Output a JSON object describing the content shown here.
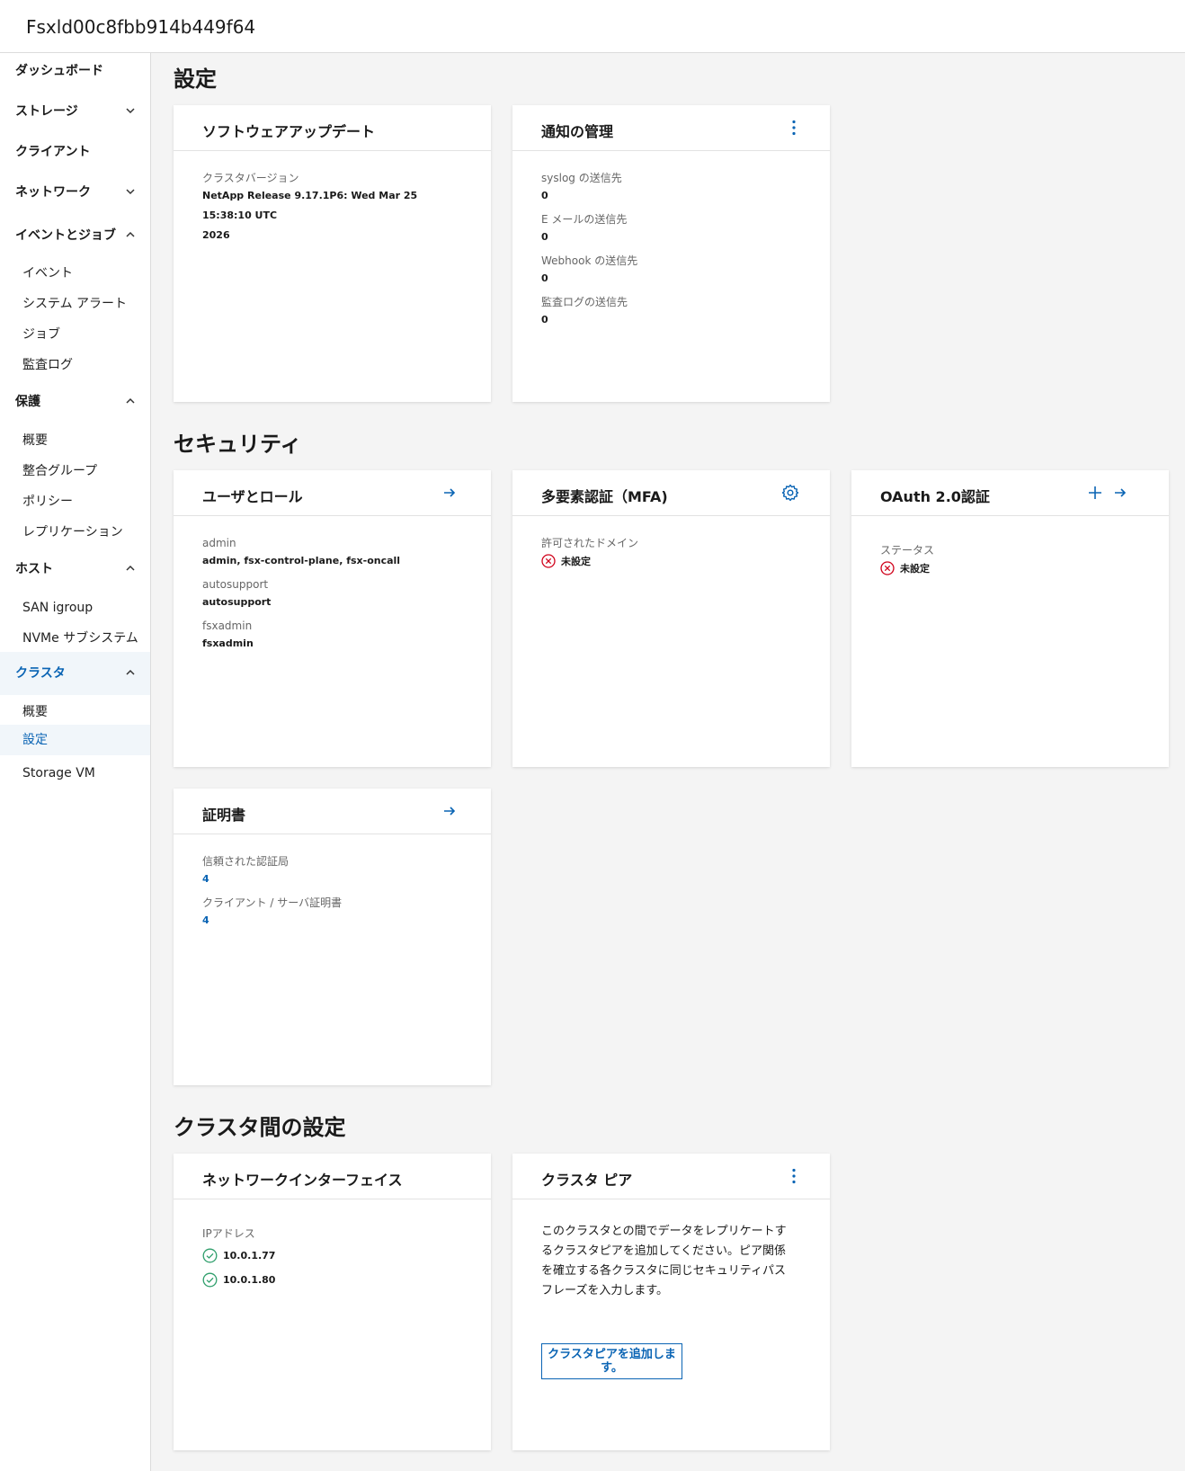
{
  "header": {
    "title": "Fsxld00c8fbb914b449f64"
  },
  "sidebar": {
    "items": [
      {
        "label": "ダッシュボード"
      },
      {
        "label": "ストレージ"
      },
      {
        "label": "クライアント"
      },
      {
        "label": "ネットワーク"
      },
      {
        "label": "イベントとジョブ"
      },
      {
        "label": "イベント"
      },
      {
        "label": "システム アラート"
      },
      {
        "label": "ジョブ"
      },
      {
        "label": "監査ログ"
      },
      {
        "label": "保護"
      },
      {
        "label": "概要"
      },
      {
        "label": "整合グループ"
      },
      {
        "label": "ポリシー"
      },
      {
        "label": "レプリケーション"
      },
      {
        "label": "ホスト"
      },
      {
        "label": "SAN igroup"
      },
      {
        "label": "NVMe サブシステム"
      },
      {
        "label": "クラスタ"
      },
      {
        "label": "概要"
      },
      {
        "label": "設定"
      },
      {
        "label": "Storage VM"
      }
    ]
  },
  "sections": {
    "settings": "設定",
    "security": "セキュリティ",
    "intercluster": "クラスタ間の設定"
  },
  "cards": {
    "software_update": {
      "title": "ソフトウェアアップデート",
      "cluster_version_label": "クラスタバージョン",
      "cluster_version_line1": "NetApp Release 9.17.1P6: Wed Mar 25 15:38:10 UTC",
      "cluster_version_line2": "2026"
    },
    "notifications": {
      "title": "通知の管理",
      "syslog_label": "syslog の送信先",
      "syslog_value": "0",
      "email_label": "E メールの送信先",
      "email_value": "0",
      "webhook_label": "Webhook の送信先",
      "webhook_value": "0",
      "audit_label": "監査ログの送信先",
      "audit_value": "0"
    },
    "users_roles": {
      "title": "ユーザとロール",
      "admin_label": "admin",
      "admin_value": "admin, fsx-control-plane, fsx-oncall",
      "autosupport_label": "autosupport",
      "autosupport_value": "autosupport",
      "fsxadmin_label": "fsxadmin",
      "fsxadmin_value": "fsxadmin"
    },
    "mfa": {
      "title": "多要素認証（MFA)",
      "domain_label": "許可されたドメイン",
      "domain_status": "未設定"
    },
    "oauth": {
      "title": "OAuth 2.0認証",
      "status_label": "ステータス",
      "status_value": "未設定"
    },
    "certificates": {
      "title": "証明書",
      "trusted_ca_label": "信頼された認証局",
      "trusted_ca_value": "4",
      "client_server_label": "クライアント / サーバ証明書",
      "client_server_value": "4"
    },
    "network_interfaces": {
      "title": "ネットワークインターフェイス",
      "ip_label": "IPアドレス",
      "ips": [
        "10.0.1.77",
        "10.0.1.80"
      ]
    },
    "cluster_peer": {
      "title": "クラスタ ピア",
      "desc_lines": [
        "このクラスタとの間でデータをレプリケートす",
        "るクラスタピアを追加してください。ピア関係",
        "を確立する各クラスタに同じセキュリティパス",
        "フレーズを入力します。"
      ],
      "add_button_line1": "クラスタピアを追加しま",
      "add_button_line2": "す。"
    }
  },
  "colors": {
    "accent": "#0a64b4",
    "error": "#d0021b",
    "success": "#2e9e6b"
  },
  "icons": [
    "chevron-down-icon",
    "chevron-up-icon",
    "kebab-menu-icon",
    "arrow-right-icon",
    "gear-icon",
    "plus-icon",
    "error-circle-icon",
    "check-circle-icon"
  ]
}
